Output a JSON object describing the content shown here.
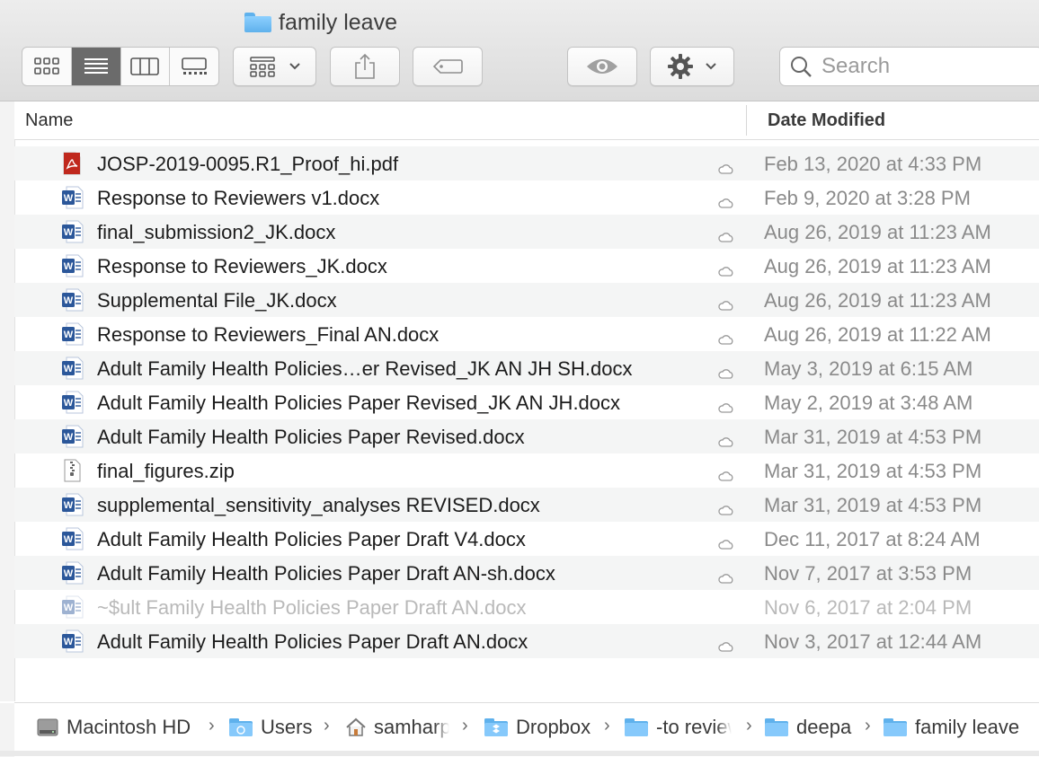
{
  "window": {
    "title": "family leave"
  },
  "toolbar": {
    "view_modes": [
      "icon-view",
      "list-view",
      "column-view",
      "gallery-view"
    ],
    "active_view": "list-view",
    "search_placeholder": "Search"
  },
  "columns": {
    "name": "Name",
    "date_modified": "Date Modified"
  },
  "files": [
    {
      "name": "JOSP-2019-0095.R1_Proof_hi.pdf",
      "date": "Feb 13, 2020 at 4:33 PM",
      "type": "pdf",
      "dimmed": false
    },
    {
      "name": "Response to Reviewers v1.docx",
      "date": "Feb 9, 2020 at 3:28 PM",
      "type": "docx",
      "dimmed": false
    },
    {
      "name": "final_submission2_JK.docx",
      "date": "Aug 26, 2019 at 11:23 AM",
      "type": "docx",
      "dimmed": false
    },
    {
      "name": "Response to Reviewers_JK.docx",
      "date": "Aug 26, 2019 at 11:23 AM",
      "type": "docx",
      "dimmed": false
    },
    {
      "name": "Supplemental File_JK.docx",
      "date": "Aug 26, 2019 at 11:23 AM",
      "type": "docx",
      "dimmed": false
    },
    {
      "name": "Response to Reviewers_Final AN.docx",
      "date": "Aug 26, 2019 at 11:22 AM",
      "type": "docx",
      "dimmed": false
    },
    {
      "name": "Adult Family Health Policies…er Revised_JK AN JH SH.docx",
      "date": "May 3, 2019 at 6:15 AM",
      "type": "docx",
      "dimmed": false
    },
    {
      "name": "Adult Family Health Policies Paper Revised_JK AN JH.docx",
      "date": "May 2, 2019 at 3:48 AM",
      "type": "docx",
      "dimmed": false
    },
    {
      "name": "Adult Family Health Policies Paper Revised.docx",
      "date": "Mar 31, 2019 at 4:53 PM",
      "type": "docx",
      "dimmed": false
    },
    {
      "name": "final_figures.zip",
      "date": "Mar 31, 2019 at 4:53 PM",
      "type": "zip",
      "dimmed": false
    },
    {
      "name": "supplemental_sensitivity_analyses REVISED.docx",
      "date": "Mar 31, 2019 at 4:53 PM",
      "type": "docx",
      "dimmed": false
    },
    {
      "name": "Adult Family Health Policies Paper Draft V4.docx",
      "date": "Dec 11, 2017 at 8:24 AM",
      "type": "docx",
      "dimmed": false
    },
    {
      "name": "Adult Family Health Policies Paper Draft AN-sh.docx",
      "date": "Nov 7, 2017 at 3:53 PM",
      "type": "docx",
      "dimmed": false
    },
    {
      "name": "~$ult Family Health Policies Paper Draft AN.docx",
      "date": "Nov 6, 2017 at 2:04 PM",
      "type": "docx",
      "dimmed": true
    },
    {
      "name": "Adult Family Health Policies Paper Draft AN.docx",
      "date": "Nov 3, 2017 at 12:44 AM",
      "type": "docx",
      "dimmed": false
    }
  ],
  "path_bar": [
    {
      "label": "Macintosh HD",
      "icon": "hard-drive-icon"
    },
    {
      "label": "Users",
      "icon": "users-folder-icon"
    },
    {
      "label": "samharp",
      "icon": "home-icon"
    },
    {
      "label": "Dropbox",
      "icon": "dropbox-folder-icon"
    },
    {
      "label": "-to review",
      "icon": "folder-icon"
    },
    {
      "label": "deepa",
      "icon": "folder-icon"
    },
    {
      "label": "family leave",
      "icon": "folder-icon"
    }
  ],
  "colors": {
    "folder": "#5fb1ec",
    "word_blue": "#2b579a",
    "pdf_red": "#c0281d",
    "date_text": "#8a8a8a",
    "active_segment": "#6b6b6b"
  }
}
